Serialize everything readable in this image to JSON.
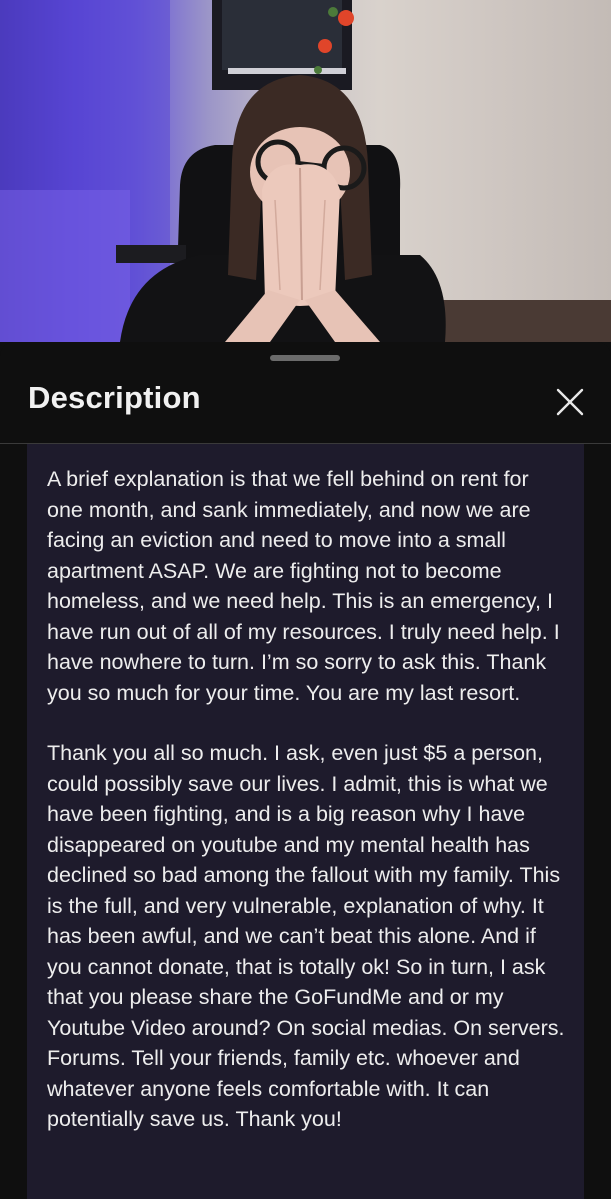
{
  "sheet": {
    "title": "Description",
    "close_icon": "close-icon"
  },
  "description": {
    "paragraphs": [
      "A brief explanation is that we fell behind on rent for one month, and sank immediately, and now we are facing an eviction and need to move into a small apartment ASAP. We are fighting not to become homeless, and we need help. This is an emergency, I have run out of all of my resources. I truly need help. I have nowhere to turn. I’m so sorry to ask this. Thank you so much for your time. You are my last resort.",
      "Thank you all so much. I ask, even just $5 a person, could possibly save our lives. I admit, this is what we have been fighting, and is a big reason why I have disappeared on youtube and my mental health has declined so bad among the fallout with my family. This is the full, and very vulnerable, explanation of why. It has been awful, and we can’t beat this alone. And if you cannot donate, that is totally ok! So in turn, I ask that you please share the GoFundMe and or my Youtube Video around? On social medias. On servers. Forums. Tell your friends, family etc. whoever and whatever anyone feels comfortable with. It can potentially save us. Thank you!"
    ]
  },
  "colors": {
    "sheet_bg": "#0f0f0f",
    "description_bg": "#1e1b2c",
    "text": "#ededed",
    "title": "#f1f1f1"
  }
}
